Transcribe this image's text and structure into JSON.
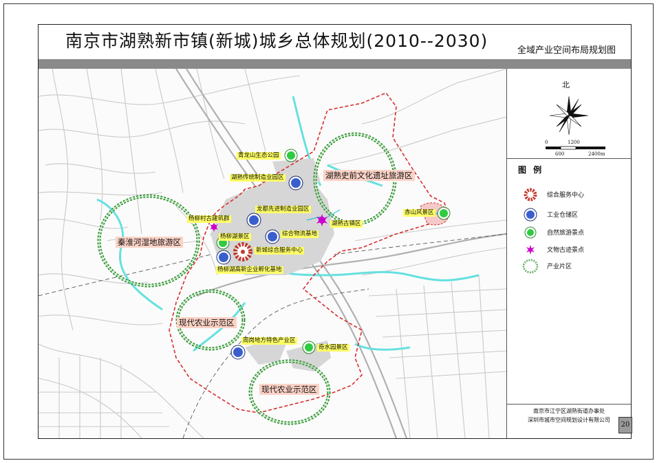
{
  "header": {
    "title": "南京市湖熟新市镇(新城)城乡总体规划(2010--2030)",
    "subtitle": "全域产业空间布局规划图"
  },
  "compass": {
    "north_label": "北"
  },
  "scale_bar": {
    "marks": [
      "0",
      "600",
      "1200",
      "2400m"
    ]
  },
  "legend": {
    "title": "图 例",
    "items": [
      {
        "symbol": "service-center-icon",
        "label": "综合服务中心",
        "color": "#c0392b"
      },
      {
        "symbol": "industrial-storage-icon",
        "label": "工业仓储区",
        "color": "#3a5fcd"
      },
      {
        "symbol": "nature-scenic-icon",
        "label": "自然旅游景点",
        "color": "#2ecc40"
      },
      {
        "symbol": "heritage-scenic-icon",
        "label": "文物古迹景点",
        "color": "#cc00cc"
      },
      {
        "symbol": "industry-zone-icon",
        "label": "产业片区",
        "color": "#2e8b2e"
      }
    ]
  },
  "credits": {
    "line1": "南京市江宁区湖熟街道办事处",
    "line2": "深圳市城市空间规划设计有限公司"
  },
  "page_number": "20",
  "map": {
    "zones": [
      {
        "id": "zone-qinhuai",
        "label": "秦淮河湿地旅游区"
      },
      {
        "id": "zone-hushu-culture",
        "label": "湖熟史前文化遗址旅游区"
      },
      {
        "id": "zone-agri-1",
        "label": "现代农业示范区"
      },
      {
        "id": "zone-agri-2",
        "label": "现代农业示范区"
      }
    ],
    "points": [
      {
        "id": "qinglongshan",
        "label": "青龙山生态公园",
        "type": "nature"
      },
      {
        "id": "traditional-mfg",
        "label": "湖熟传统制造业园区",
        "type": "industrial"
      },
      {
        "id": "longdu-mfg",
        "label": "龙都先进制造业园区",
        "type": "industrial"
      },
      {
        "id": "yangliu-village",
        "label": "杨柳村古建筑群",
        "type": "heritage"
      },
      {
        "id": "hushu-oldtown",
        "label": "湖熟古镇区",
        "type": "heritage"
      },
      {
        "id": "yangliu-lake",
        "label": "杨柳湖景区",
        "type": "nature"
      },
      {
        "id": "logistics",
        "label": "综合物流基地",
        "type": "industrial"
      },
      {
        "id": "service-center",
        "label": "新城综合服务中心",
        "type": "service"
      },
      {
        "id": "incubator",
        "label": "杨柳湖高新企业孵化基地",
        "type": "industrial"
      },
      {
        "id": "chishan",
        "label": "赤山风景区",
        "type": "nature"
      },
      {
        "id": "zhougang",
        "label": "周岗地方特色产业区",
        "type": "industrial"
      },
      {
        "id": "qishuiyuan",
        "label": "奇水园景区",
        "type": "nature"
      }
    ]
  }
}
